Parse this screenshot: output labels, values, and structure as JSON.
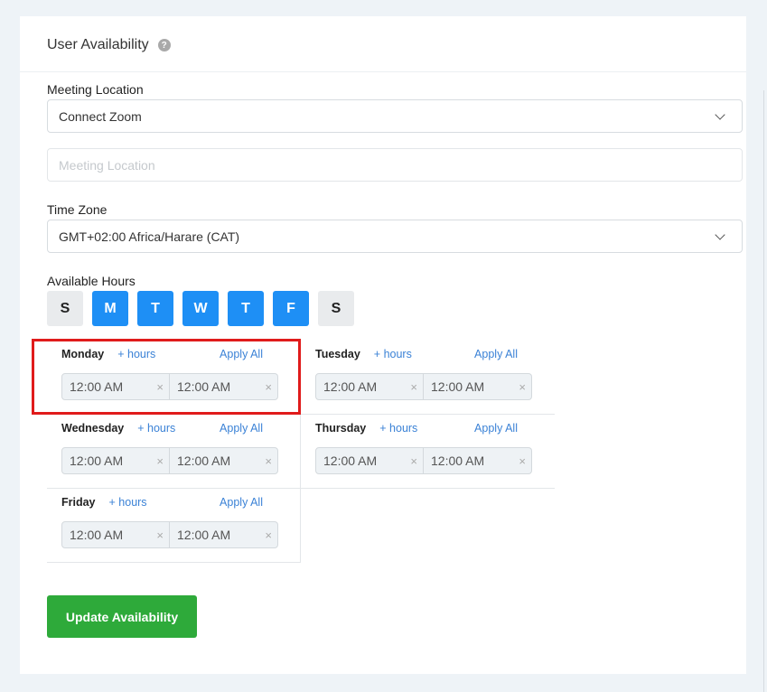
{
  "header": {
    "title": "User Availability",
    "help_icon": "question-circle-icon"
  },
  "meeting_location": {
    "label": "Meeting Location",
    "selected": "Connect Zoom",
    "input_placeholder": "Meeting Location"
  },
  "time_zone": {
    "label": "Time Zone",
    "selected": "GMT+02:00 Africa/Harare (CAT)"
  },
  "available_hours": {
    "label": "Available Hours",
    "days": [
      {
        "label": "S",
        "active": false
      },
      {
        "label": "M",
        "active": true
      },
      {
        "label": "T",
        "active": true
      },
      {
        "label": "W",
        "active": true
      },
      {
        "label": "T",
        "active": true
      },
      {
        "label": "F",
        "active": true
      },
      {
        "label": "S",
        "active": false
      }
    ]
  },
  "schedule": [
    {
      "day": "Monday",
      "add": "+ hours",
      "apply": "Apply All",
      "start": "12:00 AM",
      "end": "12:00 AM"
    },
    {
      "day": "Tuesday",
      "add": "+ hours",
      "apply": "Apply All",
      "start": "12:00 AM",
      "end": "12:00 AM"
    },
    {
      "day": "Wednesday",
      "add": "+ hours",
      "apply": "Apply All",
      "start": "12:00 AM",
      "end": "12:00 AM"
    },
    {
      "day": "Thursday",
      "add": "+ hours",
      "apply": "Apply All",
      "start": "12:00 AM",
      "end": "12:00 AM"
    },
    {
      "day": "Friday",
      "add": "+ hours",
      "apply": "Apply All",
      "start": "12:00 AM",
      "end": "12:00 AM"
    }
  ],
  "clear_symbol": "×",
  "update_button": "Update Availability"
}
